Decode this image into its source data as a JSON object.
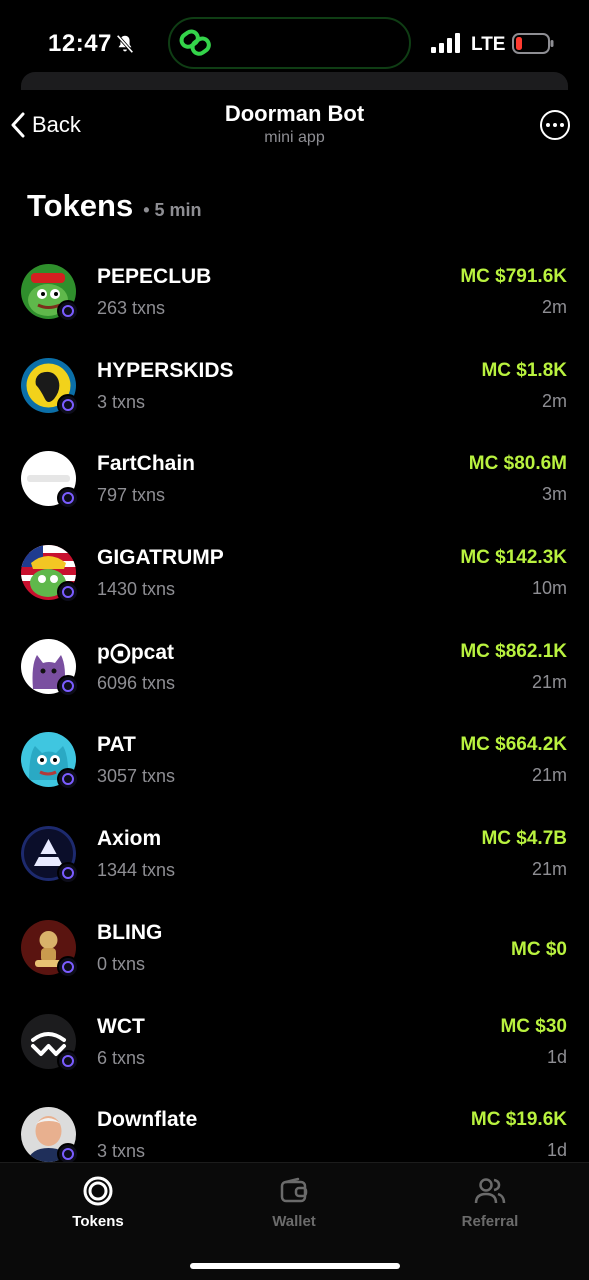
{
  "status_bar": {
    "time": "12:47",
    "network": "LTE"
  },
  "header": {
    "back_label": "Back",
    "title": "Doorman Bot",
    "subtitle": "mini app"
  },
  "section": {
    "title": "Tokens",
    "meta": "• 5 min"
  },
  "tokens": [
    {
      "name": "PEPECLUB",
      "txns": "263 txns",
      "mc": "MC $791.6K",
      "age": "2m"
    },
    {
      "name": "HYPERSKIDS",
      "txns": "3 txns",
      "mc": "MC $1.8K",
      "age": "2m"
    },
    {
      "name": "FartChain",
      "txns": "797 txns",
      "mc": "MC $80.6M",
      "age": "3m"
    },
    {
      "name": "GIGATRUMP",
      "txns": "1430 txns",
      "mc": "MC $142.3K",
      "age": "10m"
    },
    {
      "name": "p⨀pcat",
      "txns": "6096 txns",
      "mc": "MC $862.1K",
      "age": "21m"
    },
    {
      "name": "PAT",
      "txns": "3057 txns",
      "mc": "MC $664.2K",
      "age": "21m"
    },
    {
      "name": "Axiom",
      "txns": "1344 txns",
      "mc": "MC $4.7B",
      "age": "21m"
    },
    {
      "name": "BLING",
      "txns": "0 txns",
      "mc": "MC $0",
      "age": ""
    },
    {
      "name": "WCT",
      "txns": "6 txns",
      "mc": "MC $30",
      "age": "1d"
    },
    {
      "name": "Downflate",
      "txns": "3 txns",
      "mc": "MC $19.6K",
      "age": "1d"
    }
  ],
  "tabs": [
    {
      "label": "Tokens",
      "active": true
    },
    {
      "label": "Wallet",
      "active": false
    },
    {
      "label": "Referral",
      "active": false
    }
  ],
  "colors": {
    "accent": "#b9f23f",
    "muted": "#8e8e93",
    "badge_ring": "#7a5cff"
  }
}
